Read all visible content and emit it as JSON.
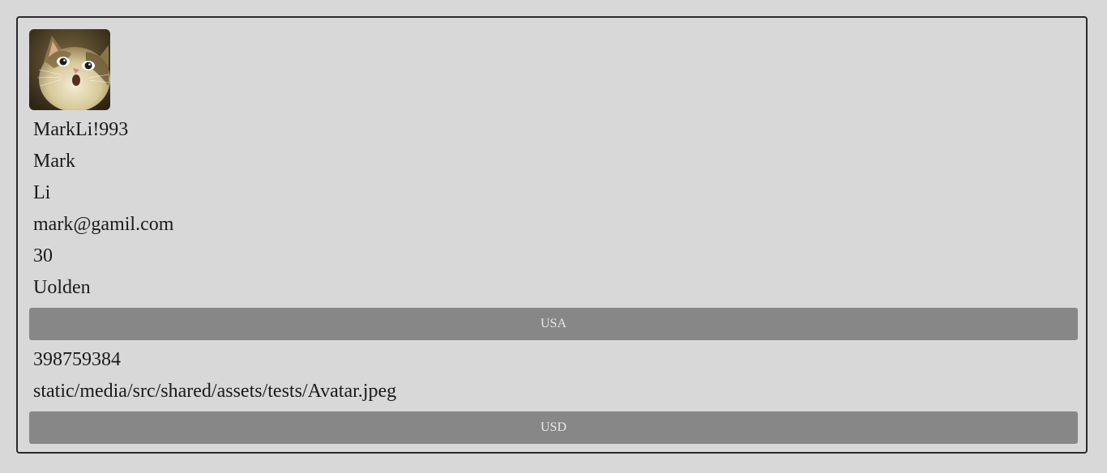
{
  "profile": {
    "avatar_icon": "cat-avatar-photo",
    "username": "MarkLi!993",
    "first_name": "Mark",
    "last_name": "Li",
    "email": "mark@gamil.com",
    "age": "30",
    "city": "Uolden",
    "country": "USA",
    "phone": "398759384",
    "avatar_path": "static/media/src/shared/assets/tests/Avatar.jpeg",
    "currency": "USD"
  },
  "colors": {
    "background": "#d8d8d8",
    "select_bg": "#878787",
    "select_text": "#e8e8e8",
    "border": "#2a2a2a"
  }
}
